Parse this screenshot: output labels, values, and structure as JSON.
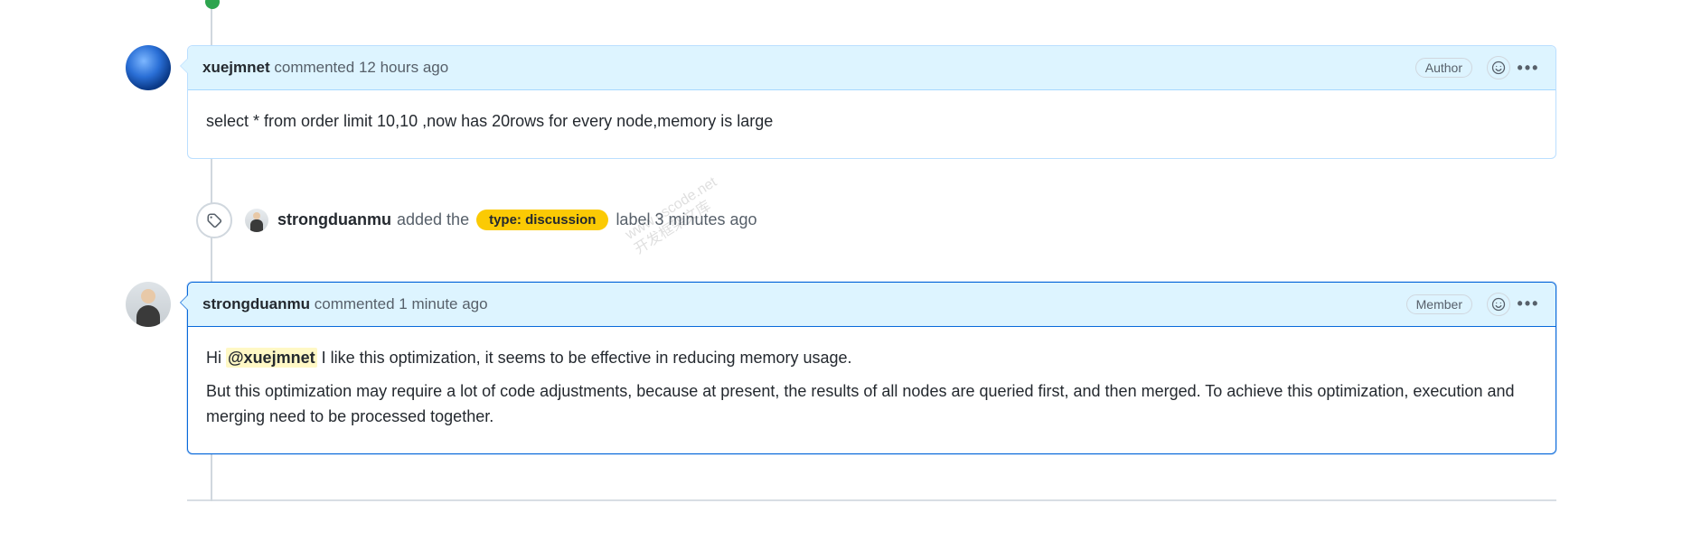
{
  "comment1": {
    "user": "xuejmnet",
    "action": "commented",
    "time": "12 hours ago",
    "badge": "Author",
    "body": "select * from order limit 10,10 ,now has 20rows for every node,memory is large"
  },
  "event1": {
    "user": "strongduanmu",
    "action_prefix": "added the",
    "label": "type: discussion",
    "action_suffix": "label",
    "time": "3 minutes ago"
  },
  "comment2": {
    "user": "strongduanmu",
    "action": "commented",
    "time": "1 minute ago",
    "badge": "Member",
    "mention": "@xuejmnet",
    "line1_prefix": "Hi ",
    "line1_suffix": " I like this optimization, it seems to be effective in reducing memory usage.",
    "line2": "But this optimization may require a lot of code adjustments, because at present, the results of all nodes are queried first, and then merged. To achieve this optimization, execution and merging need to be processed together."
  },
  "watermark": "www.cscode.net\n开发框架文库"
}
